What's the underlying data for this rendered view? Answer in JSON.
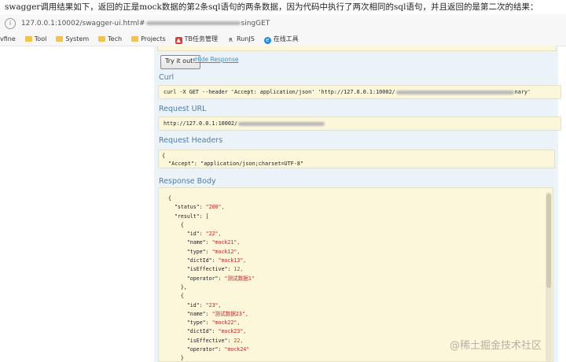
{
  "caption": "swagger调用结果如下，返回的正是mock数据的第2条sql语句的两条数据，因为代码中执行了两次相同的sql语句，并且返回的是第二次的结果：",
  "address_bar": {
    "url_prefix": "127.0.0.1:10002/swagger-ui.html#",
    "url_suffix": "singGET"
  },
  "bookmarks": [
    {
      "label": "vfine",
      "icon": "none"
    },
    {
      "label": "Tool",
      "icon": "folder"
    },
    {
      "label": "System",
      "icon": "folder"
    },
    {
      "label": "Tech",
      "icon": "folder"
    },
    {
      "label": "Projects",
      "icon": "folder"
    },
    {
      "label": "TB任务管理",
      "icon": "tb-icon"
    },
    {
      "label": "RunJS",
      "icon": "r-icon"
    },
    {
      "label": "在线工具",
      "icon": "globe-icon"
    }
  ],
  "actions": {
    "try_label": "Try it out!",
    "hide_label": "Hide Response"
  },
  "sections": {
    "curl": "Curl",
    "request_url": "Request URL",
    "request_headers": "Request Headers",
    "response_body": "Response Body"
  },
  "curl_prefix": "curl -X GET --header 'Accept: application/json' 'http://127.0.0.1:10002/",
  "curl_suffix": "nary'",
  "request_url_prefix": "http://127.0.0.1:10002/",
  "headers_open": "{",
  "headers_line": "  \"Accept\": \"application/json;charset=UTF-8\"",
  "headers_close": "}",
  "response_lines": [
    "{",
    "  \"status\": \"200\",",
    "  \"result\": [",
    "    {",
    "      \"id\": \"22\",",
    "      \"name\": \"mock21\",",
    "      \"type\": \"mock12\",",
    "      \"dictId\": \"mock13\",",
    "      \"isEffective\": 12,",
    "      \"operator\": \"测试数据1\"",
    "    },",
    "    {",
    "      \"id\": \"23\",",
    "      \"name\": \"测试数据23\",",
    "      \"type\": \"mock22\",",
    "      \"dictId\": \"mock23\",",
    "      \"isEffective\": 22,",
    "      \"operator\": \"mock24\"",
    "    }"
  ],
  "watermark": "@稀土掘金技术社区",
  "colors": {
    "panel_bg": "#ebf3f9",
    "code_bg": "#fcf6db",
    "heading": "#4b7ea8",
    "string": "#c62828",
    "link": "#3d8fd1"
  }
}
